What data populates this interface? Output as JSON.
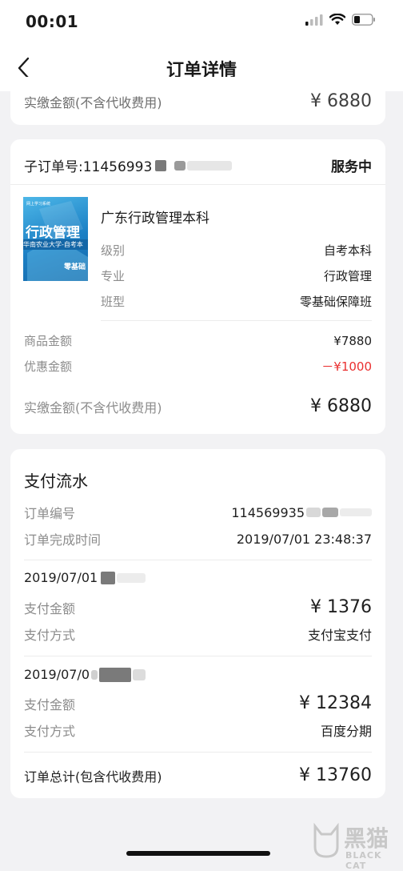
{
  "status_bar": {
    "time": "00:01"
  },
  "nav": {
    "title": "订单详情"
  },
  "top_card": {
    "paid_label": "实缴金额(不含代收费用)",
    "paid_value": "¥ 6880"
  },
  "order_card": {
    "sub_order_label": "子订单号:11456993",
    "status": "服务中",
    "thumbnail": {
      "banner": "行政管理",
      "caption": "华南农业大学-自考本",
      "small_top": "网上学习系统",
      "logo_text": "零基础"
    },
    "product_name": "广东行政管理本科",
    "attrs": [
      {
        "label": "级别",
        "value": "自考本科"
      },
      {
        "label": "专业",
        "value": "行政管理"
      },
      {
        "label": "班型",
        "value": "零基础保障班"
      }
    ],
    "price_label": "商品金额",
    "price_value": "¥7880",
    "discount_label": "优惠金额",
    "discount_value": "－¥1000",
    "paid_label": "实缴金额(不含代收费用)",
    "paid_value": "¥ 6880"
  },
  "payment_card": {
    "title": "支付流水",
    "order_no_label": "订单编号",
    "order_no_value": "114569935",
    "complete_time_label": "订单完成时间",
    "complete_time_value": "2019/07/01 23:48:37",
    "records": [
      {
        "date": "2019/07/01",
        "amount_label": "支付金额",
        "amount_value": "¥ 1376",
        "method_label": "支付方式",
        "method_value": "支付宝支付"
      },
      {
        "date": "2019/07/0",
        "amount_label": "支付金额",
        "amount_value": "¥ 12384",
        "method_label": "支付方式",
        "method_value": "百度分期"
      }
    ],
    "total_label": "订单总计(包含代收费用)",
    "total_value": "¥ 13760"
  },
  "watermark": {
    "main": "黑猫",
    "sub": "BLACK CAT",
    "colors": {
      "mark": "#c8c8c8"
    }
  }
}
